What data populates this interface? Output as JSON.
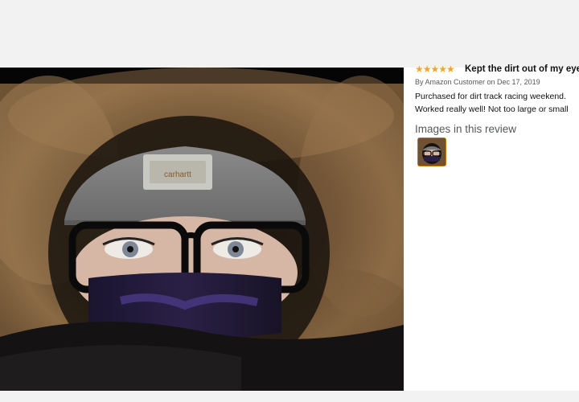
{
  "review": {
    "star_icon": "★★★★★",
    "rating": 5,
    "title": "Kept the dirt out of my eyes",
    "byline": "By Amazon Customer on Dec 17, 2019",
    "body_lines": [
      "Purchased for dirt track racing weekend.",
      "Worked really well! Not too large or small"
    ],
    "images_heading": "Images in this review"
  },
  "photo": {
    "hat_label": "carhartt",
    "icon": "review-photo"
  },
  "colors": {
    "star": "#f0a629",
    "thumb_border": "#c77800",
    "text_primary": "#0f1111",
    "text_secondary": "#565959"
  }
}
